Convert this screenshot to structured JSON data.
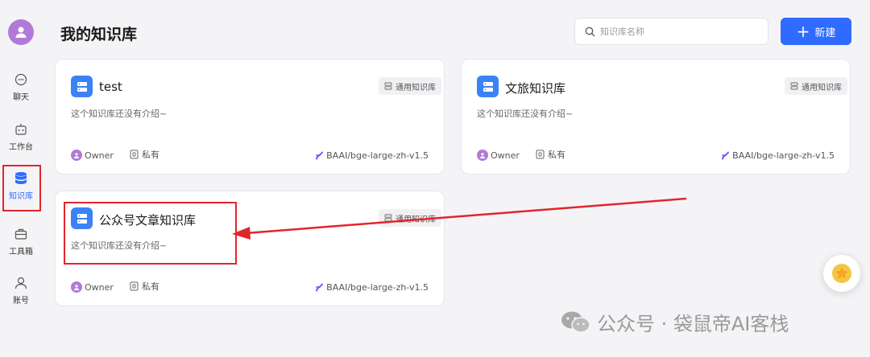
{
  "sidebar": {
    "items": [
      {
        "label": "聊天",
        "icon": "chat-icon"
      },
      {
        "label": "工作台",
        "icon": "robot-icon"
      },
      {
        "label": "知识库",
        "icon": "database-icon",
        "active": true
      },
      {
        "label": "工具箱",
        "icon": "toolbox-icon"
      },
      {
        "label": "账号",
        "icon": "user-icon"
      }
    ]
  },
  "header": {
    "title": "我的知识库",
    "search_placeholder": "知识库名称",
    "new_button_label": "新建"
  },
  "cards": [
    {
      "title": "test",
      "tag": "通用知识库",
      "description": "这个知识库还没有介绍~",
      "owner": "Owner",
      "visibility": "私有",
      "model": "BAAI/bge-large-zh-v1.5"
    },
    {
      "title": "文旅知识库",
      "tag": "通用知识库",
      "description": "这个知识库还没有介绍~",
      "owner": "Owner",
      "visibility": "私有",
      "model": "BAAI/bge-large-zh-v1.5"
    },
    {
      "title": "公众号文章知识库",
      "tag": "通用知识库",
      "description": "这个知识库还没有介绍~",
      "owner": "Owner",
      "visibility": "私有",
      "model": "BAAI/bge-large-zh-v1.5"
    }
  ],
  "watermark": {
    "text": "公众号 · 袋鼠帝AI客栈"
  },
  "colors": {
    "accent": "#2f6bff",
    "annotation": "#e0262d"
  }
}
